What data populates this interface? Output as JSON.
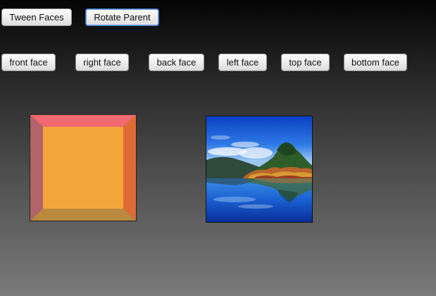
{
  "toolbar": {
    "tween_faces_label": "Tween Faces",
    "rotate_parent_label": "Rotate Parent"
  },
  "faces": {
    "front": "front face",
    "right": "right face",
    "back": "back face",
    "left": "left face",
    "top": "top face",
    "bottom": "bottom face"
  },
  "colors": {
    "face_front": "#f4a53a",
    "face_top": "#f06a70",
    "face_left": "#b3636b",
    "face_right": "#e06a35",
    "face_bottom": "#b8893e",
    "button_focus": "#3b76c9"
  }
}
